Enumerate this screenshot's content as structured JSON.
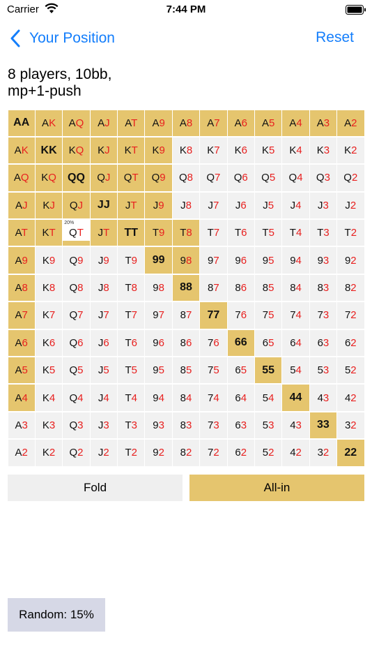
{
  "status_bar": {
    "carrier": "Carrier",
    "time": "7:44 PM"
  },
  "nav": {
    "back_label": "Your Position",
    "reset_label": "Reset"
  },
  "scenario": {
    "line1": "8 players, 10bb,",
    "line2": "mp+1-push"
  },
  "ranks": [
    "A",
    "K",
    "Q",
    "J",
    "T",
    "9",
    "8",
    "7",
    "6",
    "5",
    "4",
    "3",
    "2"
  ],
  "push_cells": [
    "0,0",
    "0,1",
    "0,2",
    "0,3",
    "0,4",
    "0,5",
    "0,6",
    "0,7",
    "0,8",
    "0,9",
    "0,10",
    "0,11",
    "0,12",
    "1,0",
    "1,1",
    "1,2",
    "1,3",
    "1,4",
    "1,5",
    "2,0",
    "2,1",
    "2,2",
    "2,3",
    "2,4",
    "2,5",
    "3,0",
    "3,1",
    "3,2",
    "3,3",
    "3,4",
    "3,5",
    "4,0",
    "4,1",
    "4,3",
    "4,4",
    "4,5",
    "4,6",
    "5,0",
    "5,5",
    "5,6",
    "6,0",
    "6,6",
    "7,0",
    "7,7",
    "8,0",
    "8,8",
    "9,0",
    "9,9",
    "10,0",
    "10,10",
    "11,11",
    "12,12"
  ],
  "mixed_cells": [
    {
      "cell": "4,2",
      "percent_label": "20%",
      "fraction": 0.2
    }
  ],
  "actions": {
    "fold_label": "Fold",
    "allin_label": "All-in"
  },
  "random_label": "Random: 15%",
  "colors": {
    "push": "#e5c56e",
    "fold": "#f1f1f1",
    "link": "#147efb",
    "suit_red": "#e8201f"
  }
}
